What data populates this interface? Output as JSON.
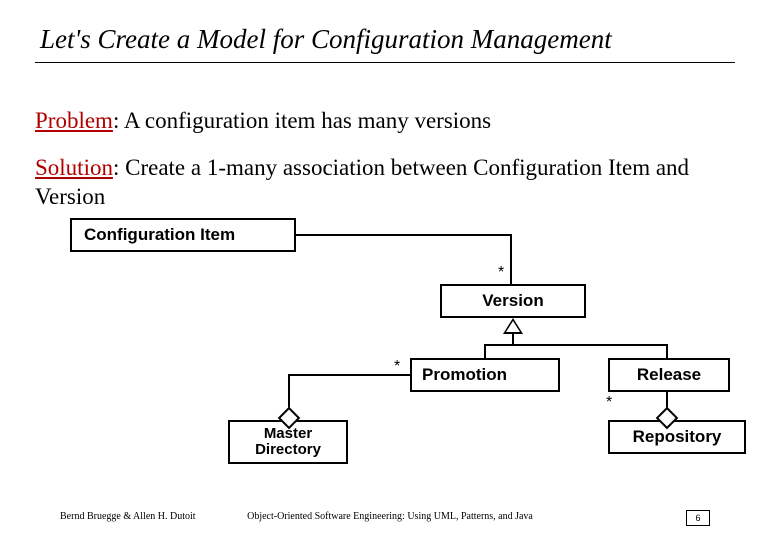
{
  "title": "Let's Create a Model for Configuration Management",
  "problem": {
    "label": "Problem",
    "text": ": A configuration item has many versions"
  },
  "solution": {
    "label": "Solution",
    "text": ": Create  a 1-many association between Configuration Item and Version"
  },
  "boxes": {
    "config": "Configuration Item",
    "version": "Version",
    "promotion": "Promotion",
    "release": "Release",
    "master": "Master Directory",
    "repository": "Repository"
  },
  "mult": {
    "version_star": "*",
    "promo_star": "*",
    "release_star": "*"
  },
  "footer": {
    "left": "Bernd Bruegge & Allen H. Dutoit",
    "center": "Object-Oriented Software Engineering: Using UML, Patterns, and Java",
    "page": "6"
  }
}
